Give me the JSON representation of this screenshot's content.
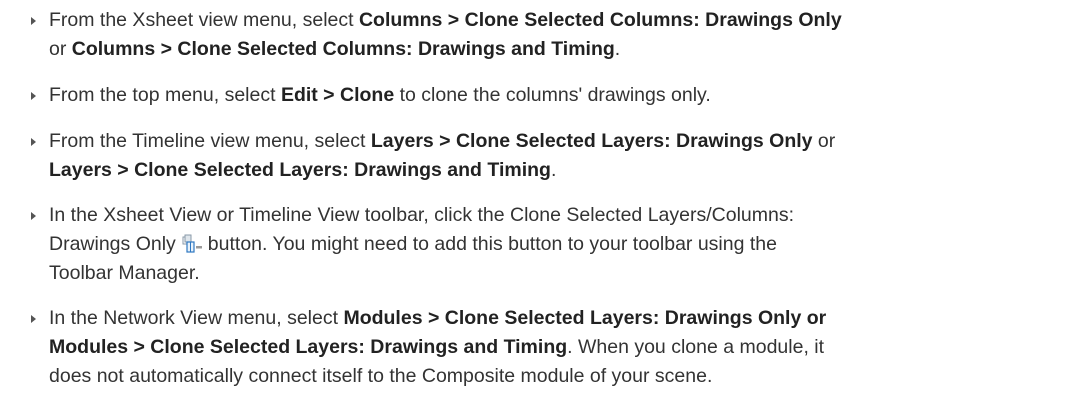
{
  "bullets": [
    {
      "lines": [
        [
          {
            "t": "From the Xsheet view menu, select "
          },
          {
            "t": "Columns > Clone Selected Columns: Drawings Only",
            "b": true
          }
        ],
        [
          {
            "t": "or "
          },
          {
            "t": "Columns > Clone Selected Columns: Drawings and Timing",
            "b": true
          },
          {
            "t": "."
          }
        ]
      ]
    },
    {
      "lines": [
        [
          {
            "t": "From the top menu, select "
          },
          {
            "t": "Edit > Clone",
            "b": true
          },
          {
            "t": " to clone the columns' drawings only."
          }
        ]
      ]
    },
    {
      "lines": [
        [
          {
            "t": "From the Timeline view menu, select "
          },
          {
            "t": "Layers > Clone Selected Layers: Drawings Only",
            "b": true
          },
          {
            "t": " or"
          }
        ],
        [
          {
            "t": "Layers > Clone Selected Layers: Drawings and Timing",
            "b": true
          },
          {
            "t": "."
          }
        ]
      ]
    },
    {
      "lines": [
        [
          {
            "t": "In the Xsheet View or Timeline View toolbar, click the Clone Selected Layers/Columns:"
          }
        ],
        [
          {
            "t": "Drawings Only"
          },
          {
            "icon": "clone-drawings-only-icon"
          },
          {
            "t": "button. You might need to add this button to your toolbar using the"
          }
        ],
        [
          {
            "t": "Toolbar Manager."
          }
        ]
      ]
    },
    {
      "lines": [
        [
          {
            "t": "In the Network View menu, select "
          },
          {
            "t": "Modules > Clone Selected Layers: Drawings Only or",
            "b": true
          }
        ],
        [
          {
            "t": "Modules > Clone Selected Layers: Drawings and Timing",
            "b": true
          },
          {
            "t": ". When you clone a module, it"
          }
        ],
        [
          {
            "t": "does not automatically connect itself to the Composite module of your scene."
          }
        ]
      ]
    }
  ]
}
